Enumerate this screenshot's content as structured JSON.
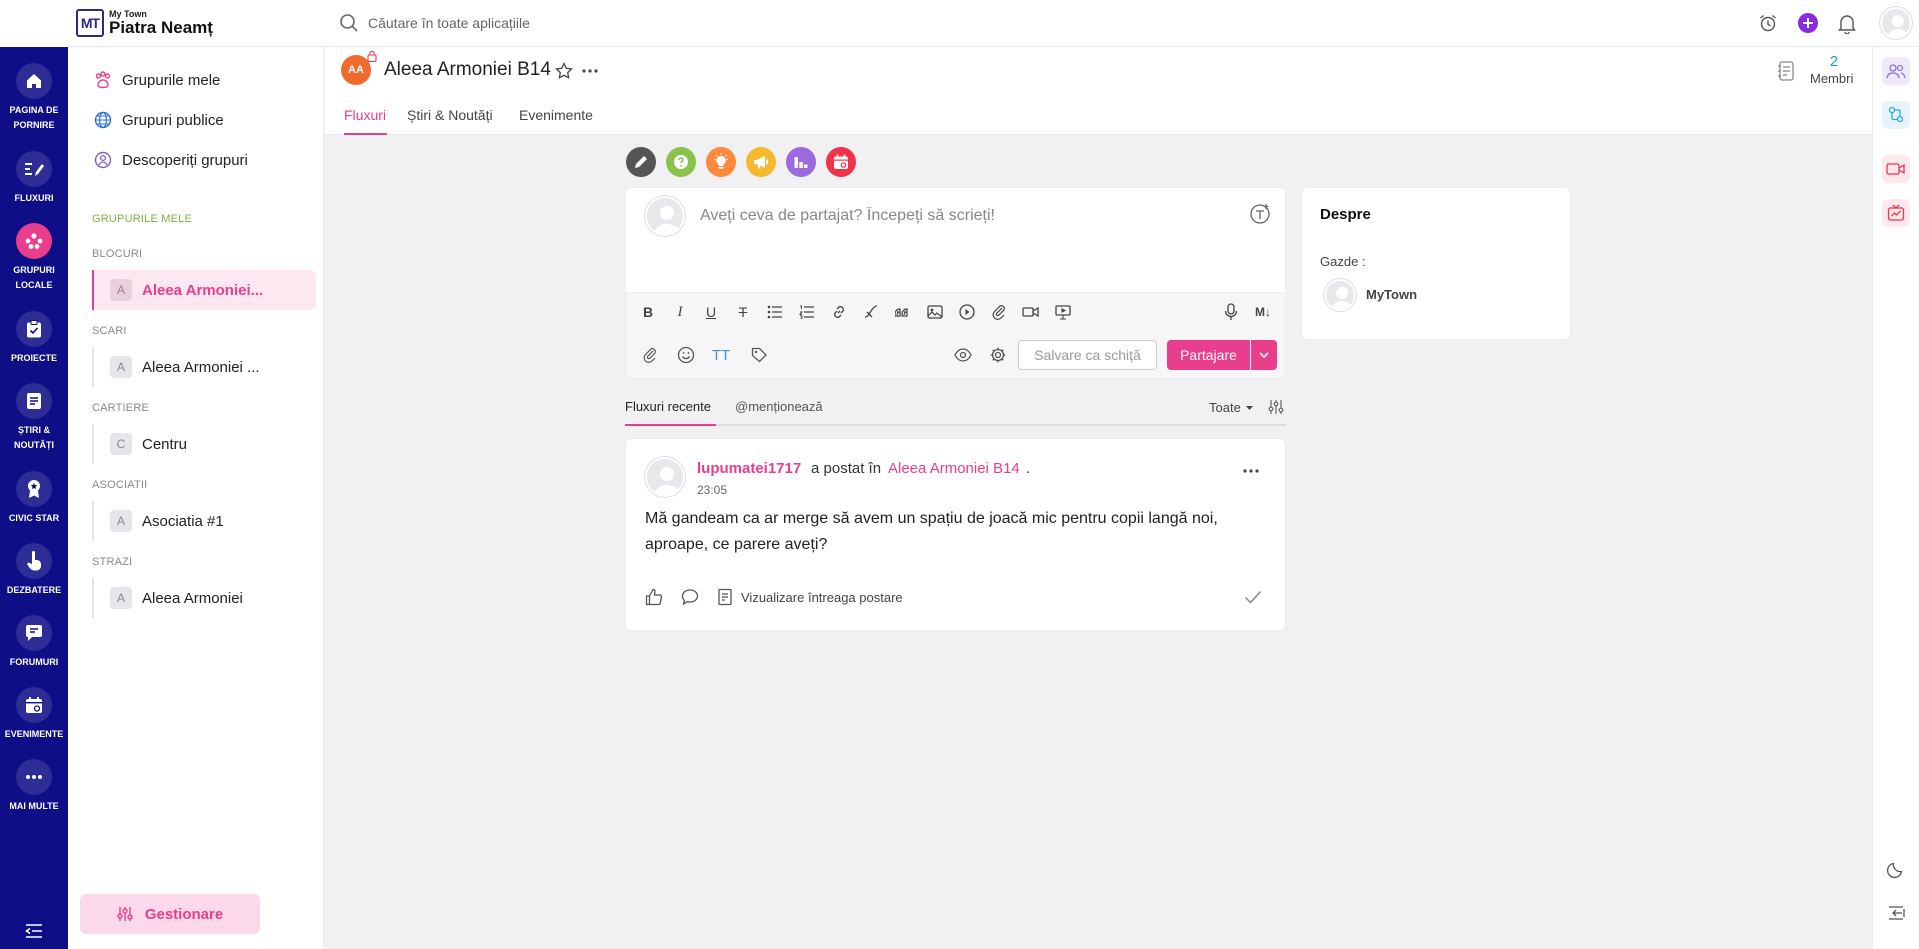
{
  "app": {
    "brand_small": "My Town",
    "brand_name": "Piatra Neamț",
    "logo_text": "MT"
  },
  "search": {
    "placeholder": "Căutare în toate aplicațiile"
  },
  "topbar": {
    "icons": [
      "alarm-clock-icon",
      "plus-circle-icon",
      "bell-icon",
      "user-avatar"
    ]
  },
  "nav": {
    "items": [
      {
        "label": "PAGINA DE PORNIRE",
        "icon": "home-icon"
      },
      {
        "label": "FLUXURI",
        "icon": "feed-icon"
      },
      {
        "label": "GRUPURI LOCALE",
        "icon": "groups-icon",
        "active": true
      },
      {
        "label": "PROIECTE",
        "icon": "clipboard-icon"
      },
      {
        "label": "ȘTIRI & NOUTĂȚI",
        "icon": "news-icon"
      },
      {
        "label": "CIVIC STAR",
        "icon": "award-icon"
      },
      {
        "label": "DEZBATERE",
        "icon": "hand-icon"
      },
      {
        "label": "FORUMURI",
        "icon": "chat-icon"
      },
      {
        "label": "EVENIMENTE",
        "icon": "calendar-icon"
      },
      {
        "label": "MAI MULTE",
        "icon": "more-icon"
      }
    ]
  },
  "groups_sidebar": {
    "links": [
      {
        "label": "Grupurile mele",
        "icon": "paw-icon"
      },
      {
        "label": "Grupuri publice",
        "icon": "globe-icon"
      },
      {
        "label": "Descoperiți grupuri",
        "icon": "discover-icon"
      }
    ],
    "my_groups_heading": "GRUPURILE MELE",
    "sections": [
      {
        "title": "BLOCURI",
        "items": [
          {
            "initial": "A",
            "label": "Aleea Armoniei...",
            "active": true
          }
        ]
      },
      {
        "title": "SCARI",
        "items": [
          {
            "initial": "A",
            "label": "Aleea Armoniei ..."
          }
        ]
      },
      {
        "title": "CARTIERE",
        "items": [
          {
            "initial": "C",
            "label": "Centru"
          }
        ]
      },
      {
        "title": "ASOCIATII",
        "items": [
          {
            "initial": "A",
            "label": "Asociatia #1"
          }
        ]
      },
      {
        "title": "STRAZI",
        "items": [
          {
            "initial": "A",
            "label": "Aleea Armoniei"
          }
        ]
      }
    ],
    "manage_label": "Gestionare"
  },
  "group": {
    "avatar_initials": "AA",
    "title": "Aleea Armoniei B14",
    "members_count": "2",
    "members_label": "Membri",
    "tabs": [
      "Fluxuri",
      "Știri & Noutăți",
      "Evenimente"
    ],
    "active_tab": 0
  },
  "post_types": [
    {
      "icon": "pencil-icon",
      "color": "#555555"
    },
    {
      "icon": "question-icon",
      "color": "#8bc34a"
    },
    {
      "icon": "lightbulb-icon",
      "color": "#ff8a3d"
    },
    {
      "icon": "megaphone-icon",
      "color": "#f5b82e"
    },
    {
      "icon": "poll-icon",
      "color": "#9c6ade"
    },
    {
      "icon": "calendar-event-icon",
      "color": "#f0324b"
    }
  ],
  "composer": {
    "placeholder": "Aveți ceva de partajat? Începeți să scrieți!",
    "draft_label": "Salvare ca schiță",
    "share_label": "Partajare"
  },
  "feed": {
    "tabs": [
      "Fluxuri recente",
      "@menționează"
    ],
    "filter_label": "Toate"
  },
  "post": {
    "author": "lupumatei1717",
    "posted_in": "a postat în",
    "group": "Aleea Armoniei B14",
    "time": "23:05",
    "body": "Mă gandeam ca ar merge să avem un spațiu de joacă mic pentru copii langă noi, aproape, ce parere aveți?",
    "view_full_label": "Vizualizare întreaga postare"
  },
  "about": {
    "title": "Despre",
    "hosts_label": "Gazde :",
    "host_name": "MyTown"
  },
  "colors": {
    "nav_bg": "#0e0e86",
    "accent": "#e83e8c",
    "teal": "#17a2b8"
  }
}
